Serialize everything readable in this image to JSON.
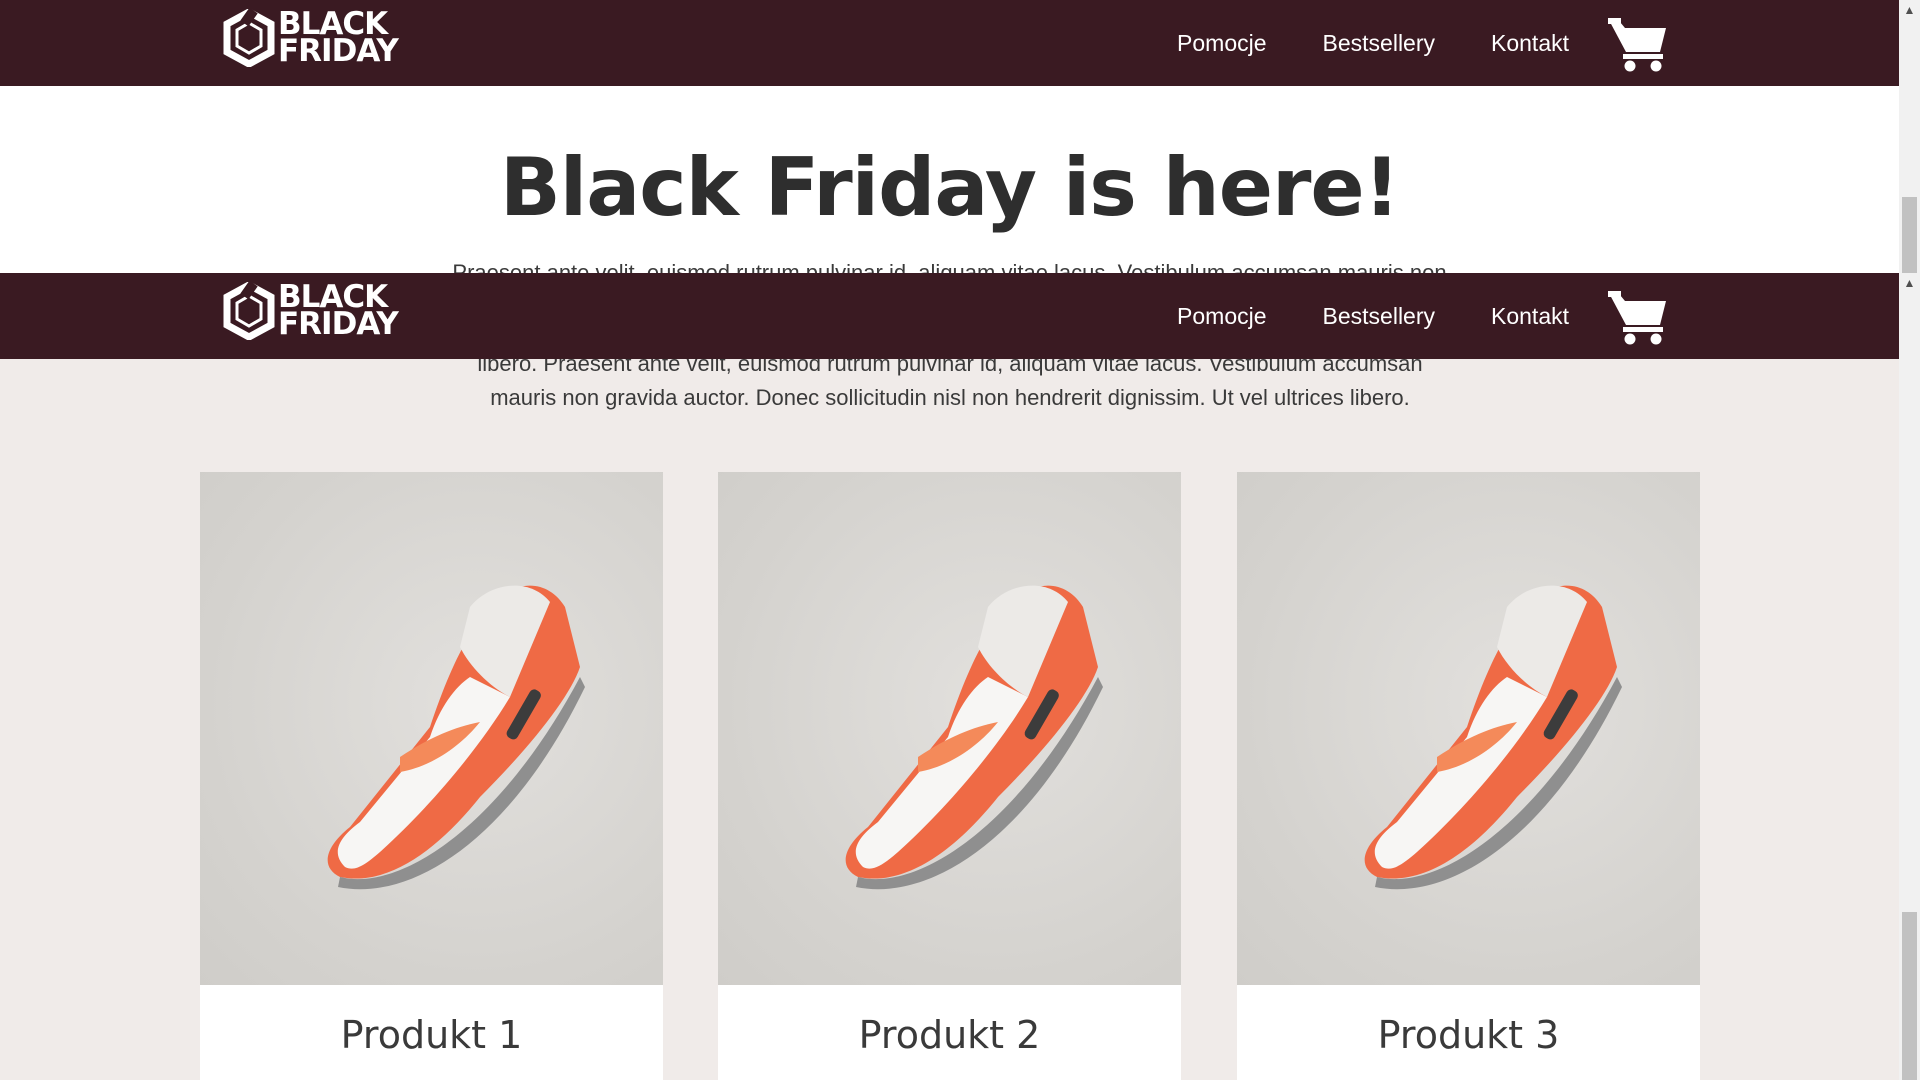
{
  "brand": {
    "logo_line1": "BLACK",
    "logo_line2": "FRIDAY"
  },
  "nav": {
    "items": [
      {
        "label": "Pomocje"
      },
      {
        "label": "Bestsellery"
      },
      {
        "label": "Kontakt"
      }
    ],
    "cart_icon": "cart-icon"
  },
  "hero": {
    "title": "Black Friday is here!",
    "line1": "Praesent ante velit, euismod rutrum pulvinar id, aliquam vitae lacus. Vestibulum accumsan mauris non",
    "rest": "libero. Praesent ante velit, euismod rutrum pulvinar id, aliquam vitae lacus. Vestibulum accumsan mauris non gravida auctor. Donec sollicitudin nisl non hendrerit dignissim. Ut vel ultrices libero."
  },
  "products": [
    {
      "name": "Produkt 1",
      "image": "sneaker-image"
    },
    {
      "name": "Produkt 2",
      "image": "sneaker-image"
    },
    {
      "name": "Produkt 3",
      "image": "sneaker-image"
    }
  ],
  "colors": {
    "navbar": "#3a1a22",
    "section_bg": "#f0ebe9",
    "text": "#2e2e2e"
  }
}
